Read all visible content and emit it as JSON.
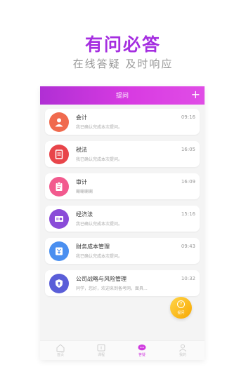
{
  "promo": {
    "title": "有问必答",
    "subtitle": "在线答疑 及时响应"
  },
  "appbar": {
    "title": "提问",
    "add_icon": "plus-icon",
    "color": "#c135dc"
  },
  "questions": [
    {
      "name": "会计",
      "time": "09:16",
      "preview": "我已确认完成本次提问。",
      "icon": "person-icon",
      "color": "#f06a4e"
    },
    {
      "name": "税法",
      "time": "16:05",
      "preview": "我已确认完成本次提问。",
      "icon": "document-icon",
      "color": "#e8454a"
    },
    {
      "name": "审计",
      "time": "16:09",
      "preview": "唰唰唰唰",
      "icon": "clipboard-icon",
      "color": "#f25a8e"
    },
    {
      "name": "经济法",
      "time": "15:16",
      "preview": "我已确认完成本次提问。",
      "icon": "scale-icon",
      "color": "#8a4bd8"
    },
    {
      "name": "财务成本管理",
      "time": "09:43",
      "preview": "我已确认完成本次提问。",
      "icon": "finance-icon",
      "color": "#4a8ff0"
    },
    {
      "name": "公司战略与风险管理",
      "time": "10:32",
      "preview": "同学，您好，欢迎来到备考网，面具...",
      "icon": "shield-icon",
      "color": "#5a5ed8"
    }
  ],
  "fab": {
    "label": "提问",
    "icon": "question-icon",
    "color": "#f7b500"
  },
  "tabbar": {
    "tabs": [
      {
        "label": "首页",
        "icon": "home-icon"
      },
      {
        "label": "课程",
        "icon": "course-icon"
      },
      {
        "label": "答疑",
        "icon": "chat-icon"
      },
      {
        "label": "我的",
        "icon": "user-icon"
      }
    ],
    "active_color": "#d03bdf"
  }
}
